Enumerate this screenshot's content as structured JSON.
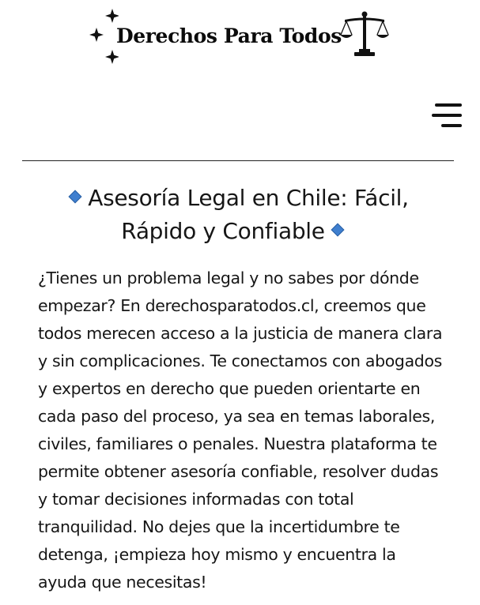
{
  "header": {
    "brand_name": "Derechos Para Todos",
    "logo_icons": [
      "sparkles-icon",
      "scales-of-justice-icon"
    ],
    "menu_icon": "hamburger-menu-icon"
  },
  "main": {
    "title": "Asesoría Legal en Chile: Fácil, Rápido y Confiable",
    "title_decoration_color": "#3f7fcf",
    "paragraph": "¿Tienes un problema legal y no sabes por dónde empezar? En derechosparatodos.cl, creemos que todos merecen acceso a la justicia de manera clara y sin complicaciones. Te conectamos con abogados y expertos en derecho que pueden orientarte en cada paso del proceso, ya sea en temas laborales, civiles, familiares o penales. Nuestra plataforma te permite obtener asesoría confiable, resolver dudas y tomar decisiones informadas con total tranquilidad. No dejes que la incertidumbre te detenga, ¡empieza hoy mismo y encuentra la ayuda que necesitas!"
  }
}
